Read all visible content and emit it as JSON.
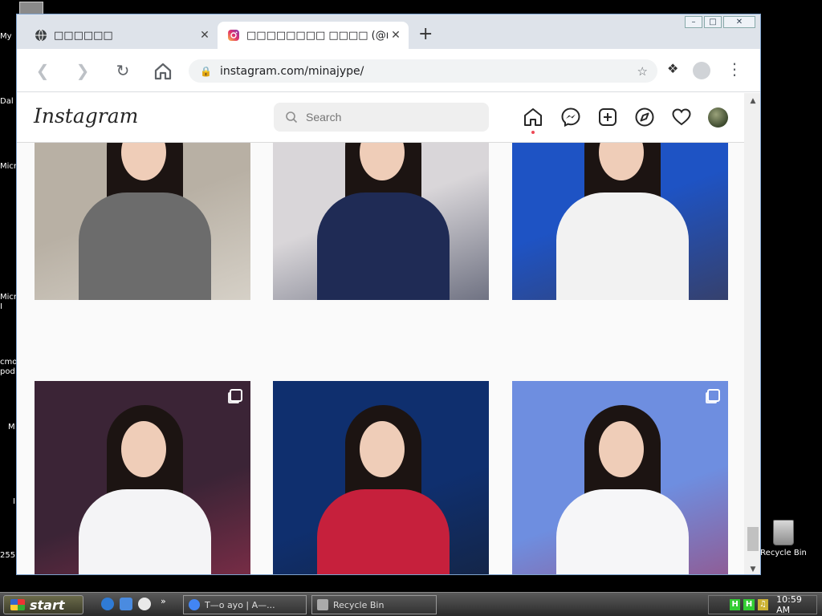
{
  "desktop": {
    "labels": [
      "My",
      "Dal",
      "Micr",
      "Micr",
      "I",
      "cmo",
      "pod",
      "M",
      "I",
      "255"
    ],
    "recycle_bin": "Recycle Bin"
  },
  "browser": {
    "tabs": [
      {
        "title": "□□□□□□",
        "active": false
      },
      {
        "title": "□□□□□□□□ □□□□ (@minajype",
        "active": true
      }
    ],
    "url": "instagram.com/minajype/"
  },
  "instagram": {
    "logo": "Instagram",
    "search_placeholder": "Search",
    "nav": [
      "home-icon",
      "messenger-icon",
      "new-post-icon",
      "explore-icon",
      "activity-heart-icon",
      "profile-avatar"
    ]
  },
  "posts": [
    {
      "multiple": true,
      "colors": [
        "#b8b0a4",
        "#6c6c6c",
        "#f0ede6"
      ]
    },
    {
      "multiple": true,
      "colors": [
        "#d9d6d9",
        "#1f2b55",
        "#121a36"
      ]
    },
    {
      "multiple": false,
      "colors": [
        "#1e53c4",
        "#f2f2f2",
        "#4a3020"
      ]
    },
    {
      "multiple": true,
      "colors": [
        "#3b2436",
        "#f4f4f6",
        "#c3375a"
      ]
    },
    {
      "multiple": false,
      "colors": [
        "#0f2f6e",
        "#c6203c",
        "#1a1a1a"
      ]
    },
    {
      "multiple": true,
      "colors": [
        "#6e8ee0",
        "#f6f6f8",
        "#b8203a"
      ]
    }
  ],
  "taskbar": {
    "start": "start",
    "quick_launch": [
      "ie-icon",
      "outlook-icon",
      "media-player-icon"
    ],
    "tasks": [
      "Т—о ауо | А—...",
      "Recycle Bin"
    ],
    "clock": "10:59 AM"
  }
}
